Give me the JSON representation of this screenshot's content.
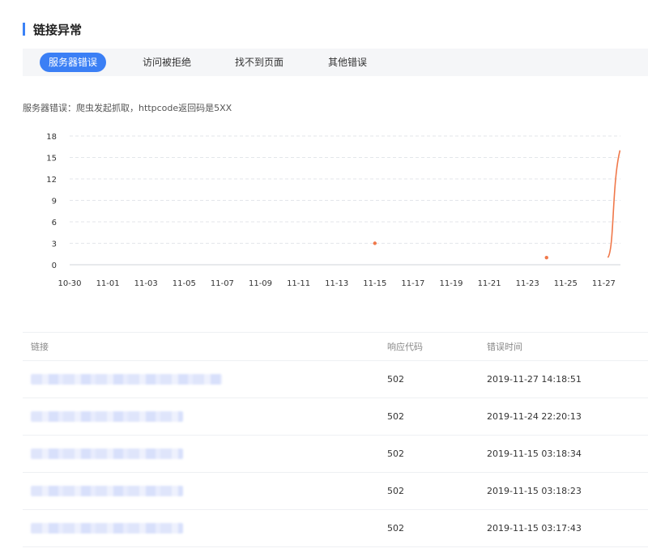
{
  "section": {
    "title": "链接异常"
  },
  "tabs": [
    {
      "label": "服务器错误",
      "active": true
    },
    {
      "label": "访问被拒绝",
      "active": false
    },
    {
      "label": "找不到页面",
      "active": false
    },
    {
      "label": "其他错误",
      "active": false
    }
  ],
  "description": "服务器错误：爬虫发起抓取，httpcode返回码是5XX",
  "colors": {
    "accent": "#3b7ff5",
    "series": "#f0784a"
  },
  "chart_data": {
    "type": "line",
    "title": "",
    "xlabel": "",
    "ylabel": "",
    "ylim": [
      0,
      18
    ],
    "yticks": [
      0,
      3,
      6,
      9,
      12,
      15,
      18
    ],
    "xticks": [
      "10-30",
      "11-01",
      "11-03",
      "11-05",
      "11-07",
      "11-09",
      "11-11",
      "11-13",
      "11-15",
      "11-17",
      "11-19",
      "11-21",
      "11-23",
      "11-25",
      "11-27"
    ],
    "grid": true,
    "series": [
      {
        "points": [
          {
            "x": "11-15",
            "y": 3
          },
          {
            "x": "11-24",
            "y": 1
          },
          {
            "x": "11-27",
            "y": 16
          }
        ]
      }
    ]
  },
  "table": {
    "headers": {
      "link": "链接",
      "code": "响应代码",
      "time": "错误时间"
    },
    "rows": [
      {
        "code": "502",
        "time": "2019-11-27 14:18:51"
      },
      {
        "code": "502",
        "time": "2019-11-24 22:20:13"
      },
      {
        "code": "502",
        "time": "2019-11-15 03:18:34"
      },
      {
        "code": "502",
        "time": "2019-11-15 03:18:23"
      },
      {
        "code": "502",
        "time": "2019-11-15 03:17:43"
      }
    ]
  }
}
